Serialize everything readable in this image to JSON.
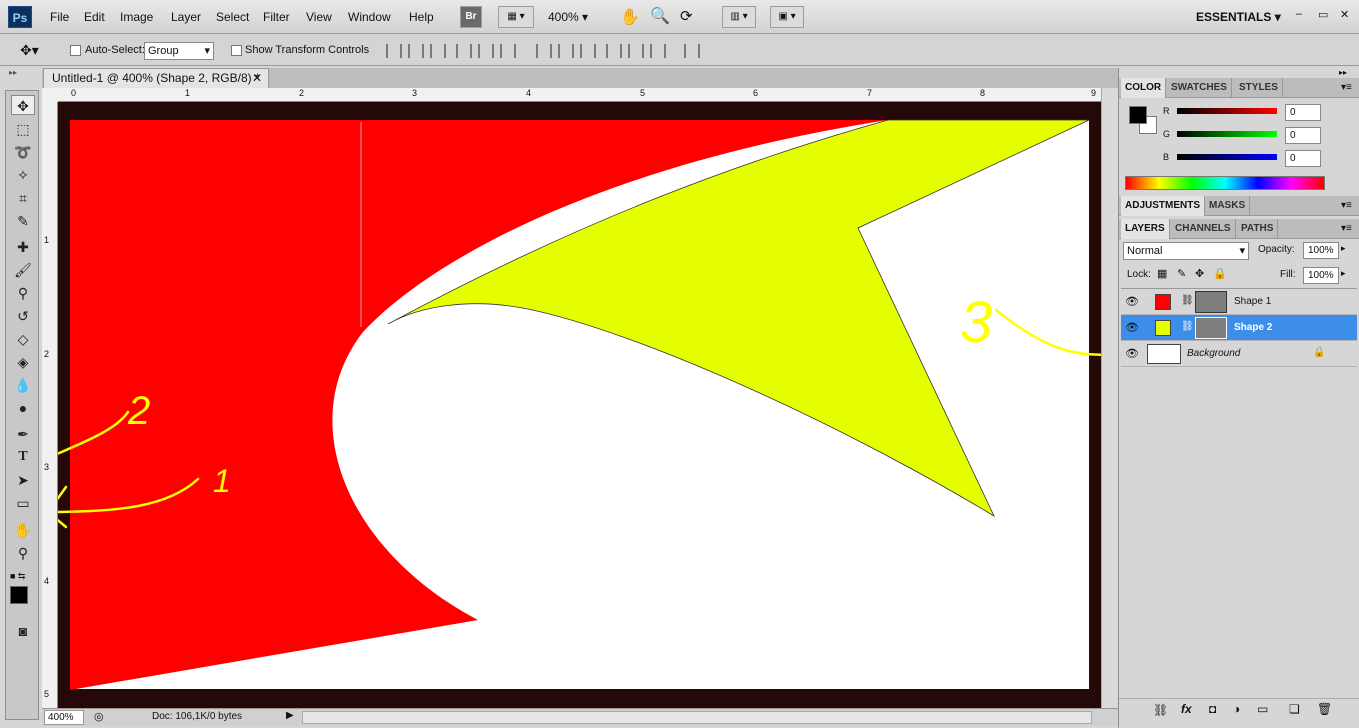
{
  "app": {
    "logo": "Ps",
    "workspace": "ESSENTIALS",
    "zoom_selector": "400%",
    "bridge_button": "Br"
  },
  "menu": [
    "File",
    "Edit",
    "Image",
    "Layer",
    "Select",
    "Filter",
    "View",
    "Window",
    "Help"
  ],
  "options": {
    "auto_select_label": "Auto-Select:",
    "auto_select_value": "Group",
    "show_transform_label": "Show Transform Controls"
  },
  "document": {
    "tab_title": "Untitled-1 @ 400% (Shape 2, RGB/8) *",
    "ruler_top": [
      "0",
      "1",
      "2",
      "3",
      "4",
      "5",
      "6",
      "7",
      "8",
      "9"
    ],
    "ruler_left": [
      "1",
      "2",
      "3",
      "4",
      "5"
    ],
    "annotations": [
      "1",
      "2",
      "3"
    ],
    "colors": {
      "shape1": "#ff0000",
      "shape2": "#e6ff00",
      "background": "#ffffff",
      "pasteboard": "#250808",
      "annotation": "#ffff00"
    }
  },
  "status": {
    "zoom": "400%",
    "doc_info": "Doc: 106,1K/0 bytes"
  },
  "color_panel": {
    "tabs": [
      "COLOR",
      "SWATCHES",
      "STYLES"
    ],
    "channels": [
      {
        "label": "R",
        "value": "0"
      },
      {
        "label": "G",
        "value": "0"
      },
      {
        "label": "B",
        "value": "0"
      }
    ]
  },
  "adjust_panel": {
    "tabs": [
      "ADJUSTMENTS",
      "MASKS"
    ]
  },
  "layers_panel": {
    "tabs": [
      "LAYERS",
      "CHANNELS",
      "PATHS"
    ],
    "blend_mode": "Normal",
    "opacity_label": "Opacity:",
    "opacity_value": "100%",
    "lock_label": "Lock:",
    "fill_label": "Fill:",
    "fill_value": "100%",
    "layers": [
      {
        "name": "Shape 1",
        "color": "#ff0000",
        "selected": false
      },
      {
        "name": "Shape 2",
        "color": "#e6ff00",
        "selected": true
      },
      {
        "name": "Background",
        "color": "#ffffff",
        "selected": false
      }
    ],
    "footer_icons": [
      "link-icon",
      "fx-icon",
      "mask-icon",
      "adjustment-icon",
      "folder-icon",
      "new-layer-icon",
      "trash-icon"
    ]
  }
}
